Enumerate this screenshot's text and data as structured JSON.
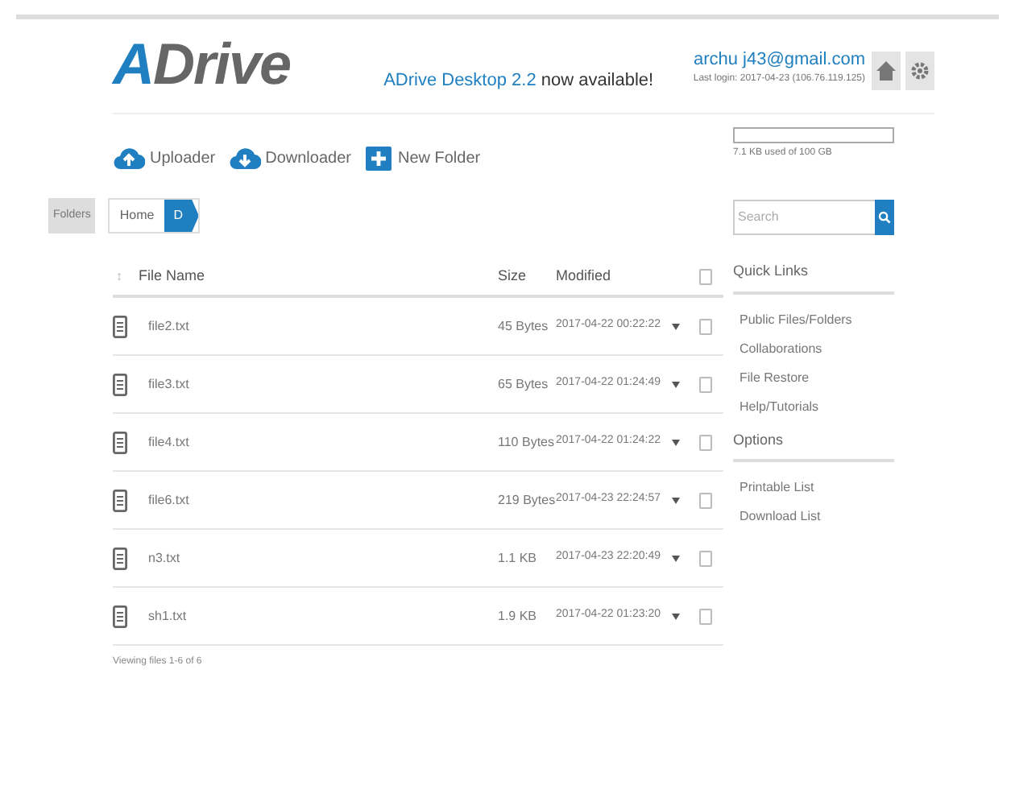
{
  "header": {
    "logo_prefix": "A",
    "logo_rest": "Drive",
    "announcement_brand": "ADrive Desktop 2.2",
    "announcement_rest": "now available!",
    "email": "archu j43@gmail.com",
    "last_login": "Last login: 2017-04-23 (106.76.119.125)"
  },
  "toolbar": [
    {
      "kind": "upload",
      "label": "Uploader"
    },
    {
      "kind": "download",
      "label": "Downloader"
    },
    {
      "kind": "folder",
      "label": "New Folder"
    }
  ],
  "storage": {
    "text": "7.1 KB used of 100 GB"
  },
  "folders_button": "Folders",
  "breadcrumb": [
    {
      "label": "Home",
      "selected": false
    },
    {
      "label": "D",
      "selected": true
    }
  ],
  "search": {
    "placeholder": "Search"
  },
  "table": {
    "sort_mark": "↕",
    "columns": [
      "File Name",
      "Size",
      "Modified"
    ],
    "select_all_checked": false,
    "rows": [
      {
        "name": "file2.txt",
        "size": "45 Bytes",
        "modified": "2017-04-22 00:22:22",
        "checked": false
      },
      {
        "name": "file3.txt",
        "size": "65 Bytes",
        "modified": "2017-04-22 01:24:49",
        "checked": false
      },
      {
        "name": "file4.txt",
        "size": "110 Bytes",
        "modified": "2017-04-22 01:24:22",
        "checked": false
      },
      {
        "name": "file6.txt",
        "size": "219 Bytes",
        "modified": "2017-04-23 22:24:57",
        "checked": false
      },
      {
        "name": "n3.txt",
        "size": "1.1 KB",
        "modified": "2017-04-23 22:20:49",
        "checked": false
      },
      {
        "name": "sh1.txt",
        "size": "1.9 KB",
        "modified": "2017-04-22 01:23:20",
        "checked": false
      }
    ],
    "footer": "Viewing files 1-6 of 6"
  },
  "sidebar": [
    {
      "title": "Quick Links",
      "items": [
        "Public Files/Folders",
        "Collaborations",
        "File Restore",
        "Help/Tutorials"
      ]
    },
    {
      "title": "Options",
      "items": [
        "Printable List",
        "Download List"
      ]
    }
  ]
}
